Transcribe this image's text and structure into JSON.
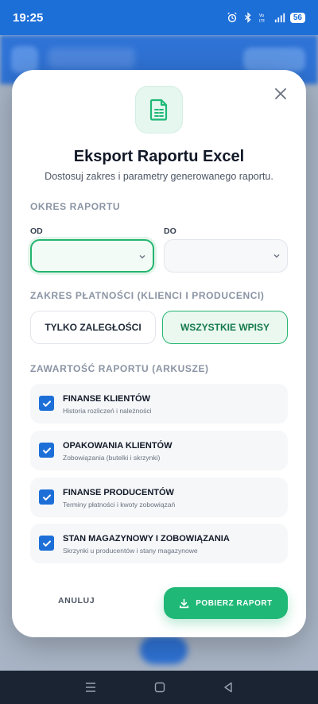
{
  "status_bar": {
    "time": "19:25",
    "battery": "56"
  },
  "modal": {
    "title": "Eksport Raportu Excel",
    "subtitle": "Dostosuj zakres i parametry generowanego raportu.",
    "period": {
      "section": "OKRES RAPORTU",
      "from_label": "OD",
      "to_label": "DO",
      "from_value": "",
      "to_value": ""
    },
    "payment_range": {
      "section": "ZAKRES PŁATNOŚCI (KLIENCI I PRODUCENCI)",
      "options": [
        "TYLKO ZALEGŁOŚCI",
        "WSZYSTKIE WPISY"
      ],
      "selected": "WSZYSTKIE WPISY"
    },
    "contents": {
      "section": "ZAWARTOŚĆ RAPORTU (ARKUSZE)",
      "sheets": [
        {
          "title": "FINANSE KLIENTÓW",
          "subtitle": "Historia rozliczeń i należności",
          "checked": true
        },
        {
          "title": "OPAKOWANIA KLIENTÓW",
          "subtitle": "Zobowiązania (butelki i skrzynki)",
          "checked": true
        },
        {
          "title": "FINANSE PRODUCENTÓW",
          "subtitle": "Terminy płatności i kwoty zobowiązań",
          "checked": true
        },
        {
          "title": "STAN MAGAZYNOWY I ZOBOWIĄZANIA",
          "subtitle": "Skrzynki u producentów i stany magazynowe",
          "checked": true
        }
      ]
    },
    "actions": {
      "cancel": "ANULUJ",
      "download": "POBIERZ RAPORT"
    }
  },
  "colors": {
    "accent": "#1fb877",
    "checkbox": "#1d6fd8",
    "status_bar": "#1d6fd8"
  }
}
